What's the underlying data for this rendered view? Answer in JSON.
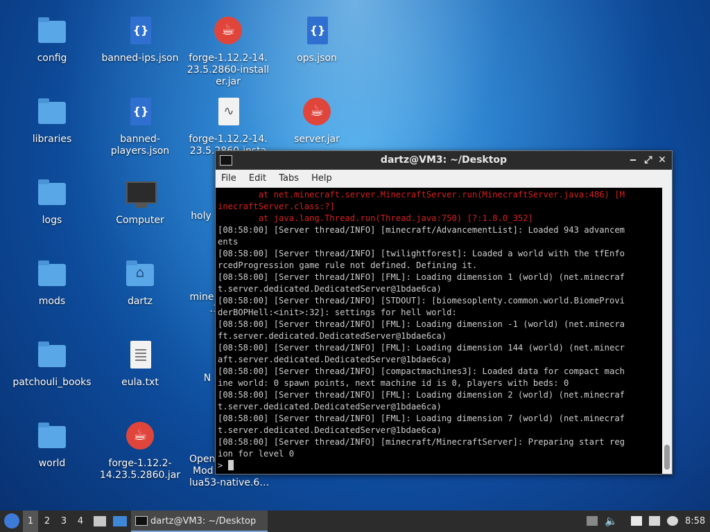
{
  "desktop_icons": [
    {
      "label": "config",
      "type": "folder"
    },
    {
      "label": "banned-ips.json",
      "type": "json"
    },
    {
      "label": "forge-1.12.2-14.23.5.2860-installer.jar",
      "type": "jar"
    },
    {
      "label": "ops.json",
      "type": "json"
    },
    {
      "label": "libraries",
      "type": "folder"
    },
    {
      "label": "banned-players.json",
      "type": "json"
    },
    {
      "label": "forge-1.12.2-14.23.5.2860-insta",
      "type": "log"
    },
    {
      "label": "server.jar",
      "type": "jar"
    },
    {
      "label": "logs",
      "type": "folder"
    },
    {
      "label": "Computer",
      "type": "computer"
    },
    {
      "label": "holy",
      "type": "hidden"
    },
    {
      "label": "mods",
      "type": "folder"
    },
    {
      "label": "dartz",
      "type": "home"
    },
    {
      "label": "mine",
      "type": "hidden"
    },
    {
      "label": ".1",
      "type": "hidden"
    },
    {
      "label": "patchouli_books",
      "type": "folder"
    },
    {
      "label": "eula.txt",
      "type": "text"
    },
    {
      "label": "N",
      "type": "hidden"
    },
    {
      "label": "world",
      "type": "folder"
    },
    {
      "label": "forge-1.12.2-14.23.5.2860.jar",
      "type": "jar"
    },
    {
      "label": "Open",
      "type": "hidden"
    },
    {
      "label": "Mod",
      "type": "hidden"
    },
    {
      "label": "lua53-native.6…",
      "type": "hidden"
    }
  ],
  "terminal": {
    "title": "dartz@VM3: ~/Desktop",
    "menu": [
      "File",
      "Edit",
      "Tabs",
      "Help"
    ],
    "lines": [
      {
        "text": "        at net.minecraft.server.MinecraftServer.run(MinecraftServer.java:486) [M",
        "err": true
      },
      {
        "text": "inecraftServer.class:?]",
        "err": true
      },
      {
        "text": "        at java.lang.Thread.run(Thread.java:750) [?:1.8.0_352]",
        "err": true
      },
      {
        "text": "[08:58:00] [Server thread/INFO] [minecraft/AdvancementList]: Loaded 943 advancem",
        "err": false
      },
      {
        "text": "ents",
        "err": false
      },
      {
        "text": "[08:58:00] [Server thread/INFO] [twilightforest]: Loaded a world with the tfEnfo",
        "err": false
      },
      {
        "text": "rcedProgression game rule not defined. Defining it.",
        "err": false
      },
      {
        "text": "[08:58:00] [Server thread/INFO] [FML]: Loading dimension 1 (world) (net.minecraf",
        "err": false
      },
      {
        "text": "t.server.dedicated.DedicatedServer@1bdae6ca)",
        "err": false
      },
      {
        "text": "[08:58:00] [Server thread/INFO] [STDOUT]: [biomesoplenty.common.world.BiomeProvi",
        "err": false
      },
      {
        "text": "derBOPHell:<init>:32]: settings for hell world:",
        "err": false
      },
      {
        "text": "[08:58:00] [Server thread/INFO] [FML]: Loading dimension -1 (world) (net.minecra",
        "err": false
      },
      {
        "text": "ft.server.dedicated.DedicatedServer@1bdae6ca)",
        "err": false
      },
      {
        "text": "[08:58:00] [Server thread/INFO] [FML]: Loading dimension 144 (world) (net.minecr",
        "err": false
      },
      {
        "text": "aft.server.dedicated.DedicatedServer@1bdae6ca)",
        "err": false
      },
      {
        "text": "[08:58:00] [Server thread/INFO] [compactmachines3]: Loaded data for compact mach",
        "err": false
      },
      {
        "text": "ine world: 0 spawn points, next machine id is 0, players with beds: 0",
        "err": false
      },
      {
        "text": "[08:58:00] [Server thread/INFO] [FML]: Loading dimension 2 (world) (net.minecraf",
        "err": false
      },
      {
        "text": "t.server.dedicated.DedicatedServer@1bdae6ca)",
        "err": false
      },
      {
        "text": "[08:58:00] [Server thread/INFO] [FML]: Loading dimension 7 (world) (net.minecraf",
        "err": false
      },
      {
        "text": "t.server.dedicated.DedicatedServer@1bdae6ca)",
        "err": false
      },
      {
        "text": "[08:58:00] [Server thread/INFO] [minecraft/MinecraftServer]: Preparing start reg",
        "err": false
      },
      {
        "text": "ion for level 0",
        "err": false
      }
    ],
    "prompt": ">"
  },
  "taskbar": {
    "workspaces": [
      "1",
      "2",
      "3",
      "4"
    ],
    "active_workspace": "1",
    "task_label": "dartz@VM3: ~/Desktop",
    "clock": "8:58"
  }
}
